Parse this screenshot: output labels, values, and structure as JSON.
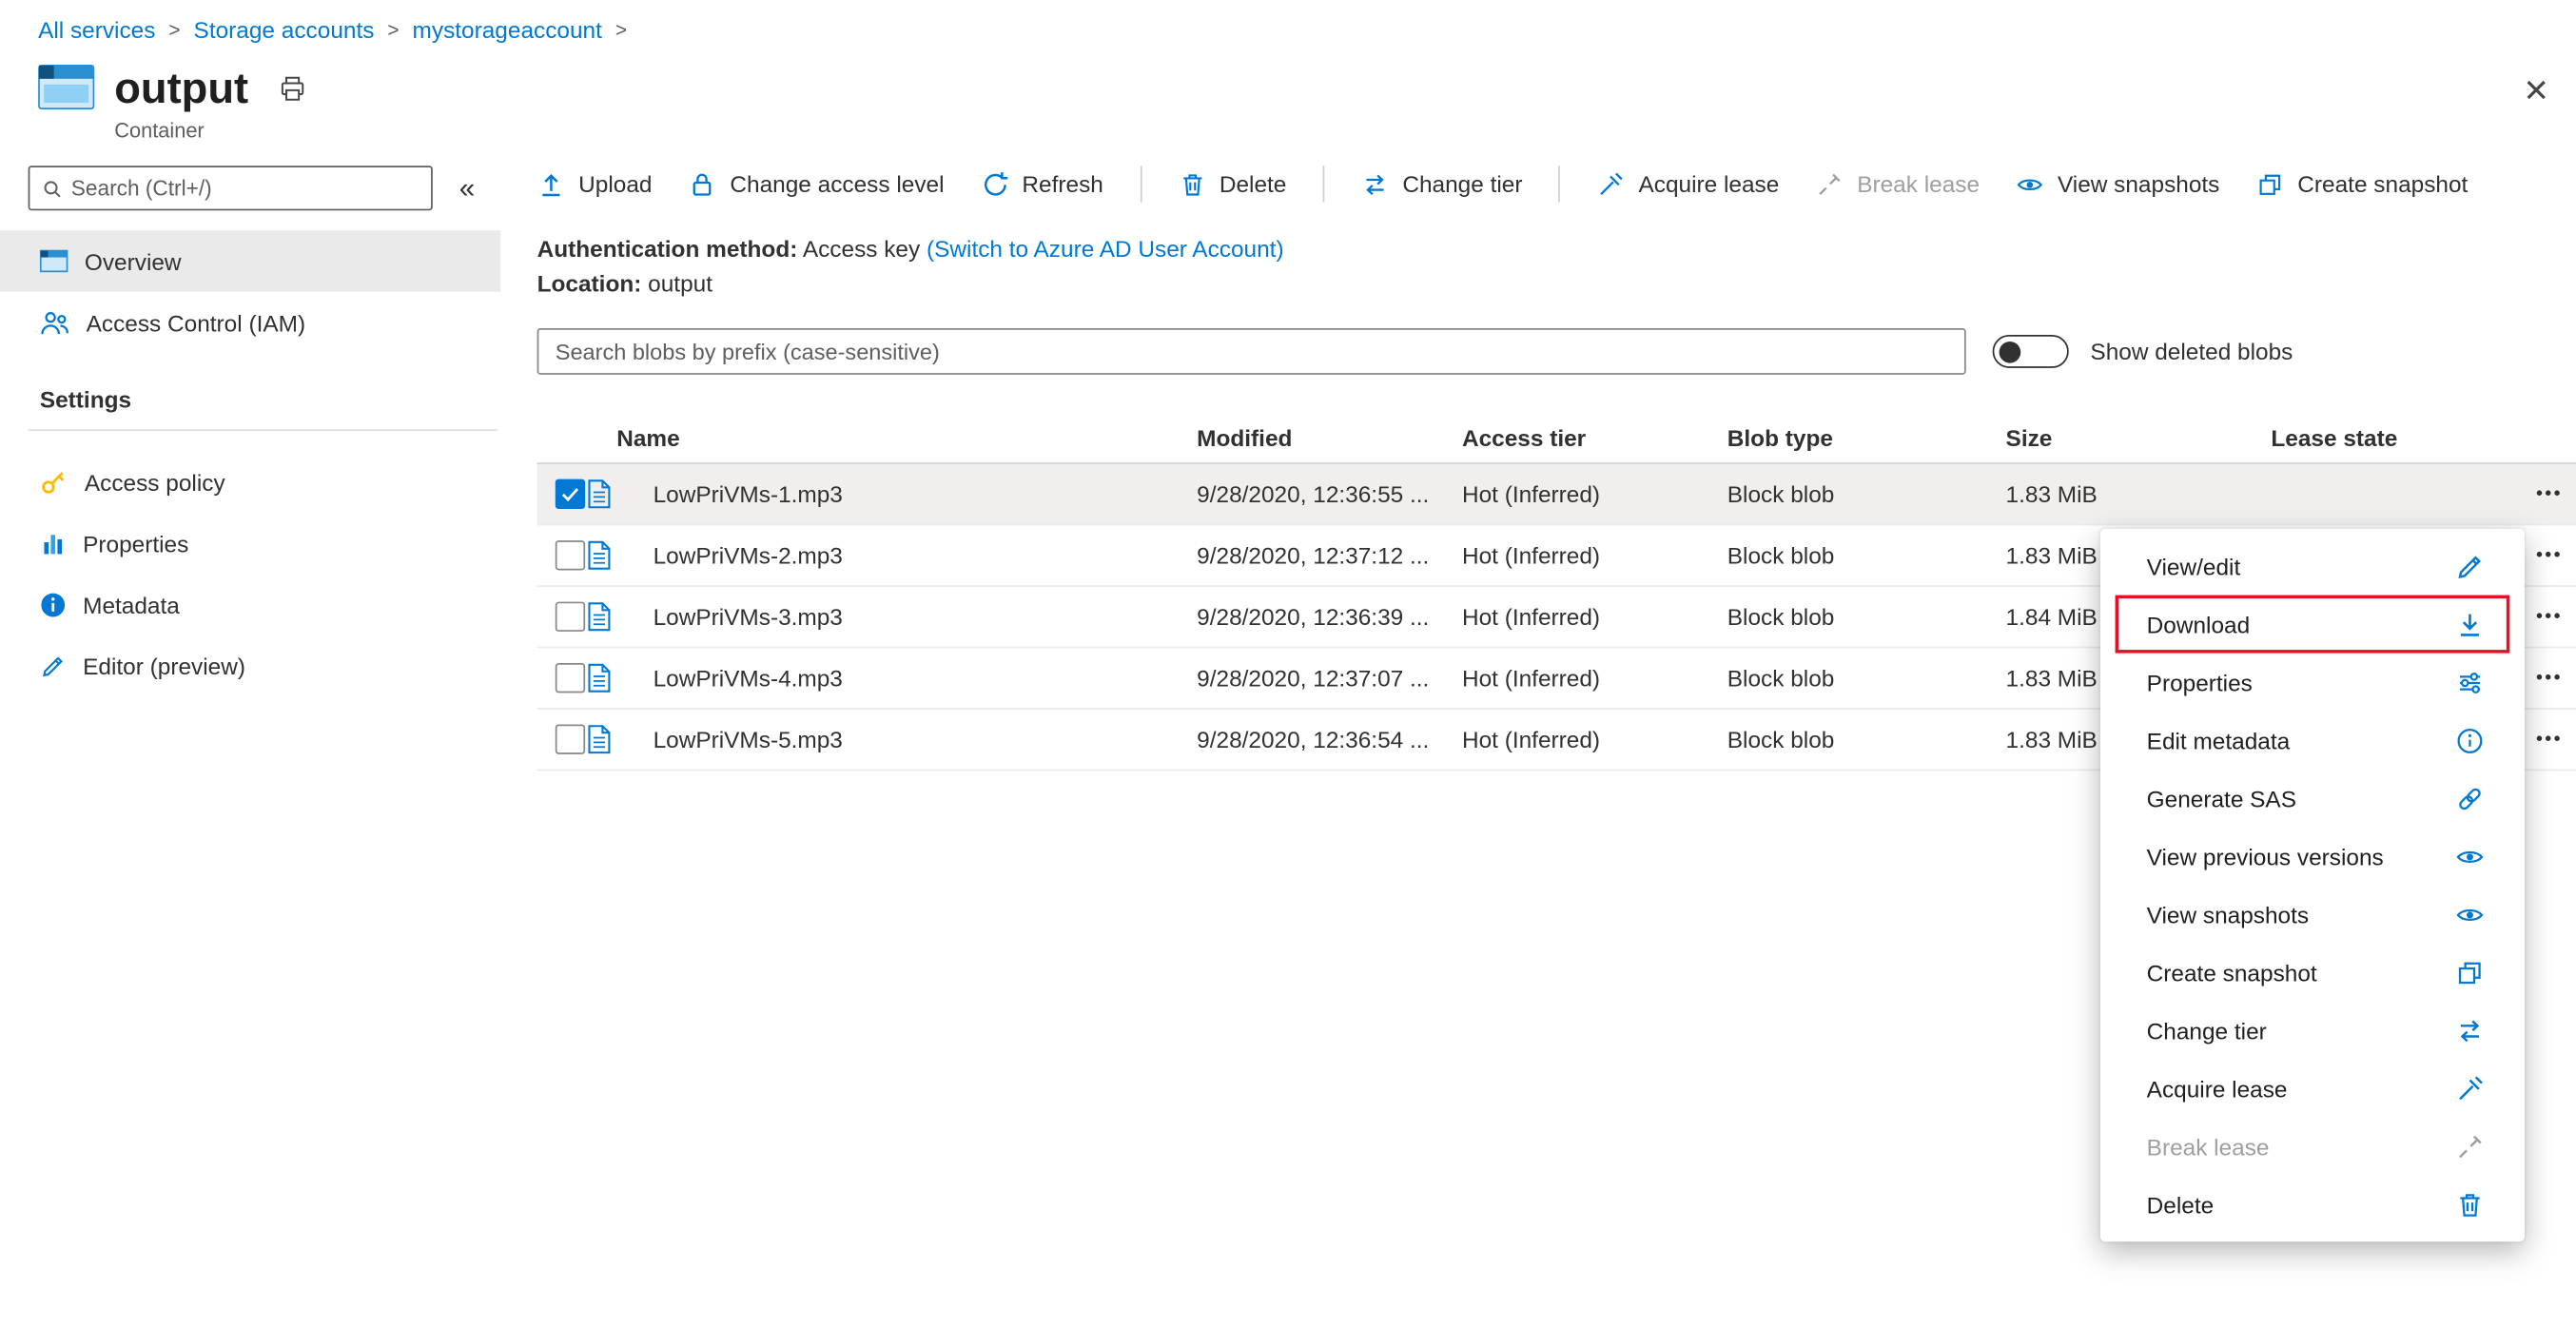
{
  "colors": {
    "accent": "#0078d4",
    "download_highlight_border": "#e81123",
    "selected_row_bg": "#f0efee",
    "disabled_text": "#a19f9d",
    "key_icon_yellow": "#ffb900"
  },
  "icons": {
    "close": "✕",
    "collapse": "«",
    "row_menu": "•••",
    "breadcrumb_separator": ">"
  },
  "breadcrumb": {
    "items": [
      "All services",
      "Storage accounts",
      "mystorageaccount"
    ]
  },
  "header": {
    "title": "output",
    "subtitle": "Container"
  },
  "sidebar": {
    "search_placeholder": "Search (Ctrl+/)",
    "items": [
      {
        "label": "Overview",
        "selected": true
      },
      {
        "label": "Access Control (IAM)",
        "selected": false
      }
    ],
    "settings_header": "Settings",
    "settings_items": [
      {
        "label": "Access policy"
      },
      {
        "label": "Properties"
      },
      {
        "label": "Metadata"
      },
      {
        "label": "Editor (preview)"
      }
    ]
  },
  "toolbar": {
    "items": [
      {
        "label": "Upload",
        "disabled": false
      },
      {
        "label": "Change access level",
        "disabled": false
      },
      {
        "label": "Refresh",
        "disabled": false
      },
      {
        "label": "Delete",
        "disabled": false
      },
      {
        "label": "Change tier",
        "disabled": false
      },
      {
        "label": "Acquire lease",
        "disabled": false
      },
      {
        "label": "Break lease",
        "disabled": true
      },
      {
        "label": "View snapshots",
        "disabled": false
      },
      {
        "label": "Create snapshot",
        "disabled": false
      }
    ]
  },
  "info": {
    "auth_label": "Authentication method:",
    "auth_value": "Access key",
    "auth_link": "(Switch to Azure AD User Account)",
    "location_label": "Location:",
    "location_value": "output"
  },
  "filter": {
    "search_placeholder": "Search blobs by prefix (case-sensitive)",
    "toggle_label": "Show deleted blobs",
    "toggle_on": false
  },
  "table": {
    "columns": [
      "Name",
      "Modified",
      "Access tier",
      "Blob type",
      "Size",
      "Lease state"
    ],
    "rows": [
      {
        "name": "LowPriVMs-1.mp3",
        "modified": "9/28/2020, 12:36:55 ...",
        "access_tier": "Hot (Inferred)",
        "blob_type": "Block blob",
        "size": "1.83 MiB",
        "checked": true
      },
      {
        "name": "LowPriVMs-2.mp3",
        "modified": "9/28/2020, 12:37:12 ...",
        "access_tier": "Hot (Inferred)",
        "blob_type": "Block blob",
        "size": "1.83 MiB",
        "checked": false
      },
      {
        "name": "LowPriVMs-3.mp3",
        "modified": "9/28/2020, 12:36:39 ...",
        "access_tier": "Hot (Inferred)",
        "blob_type": "Block blob",
        "size": "1.84 MiB",
        "checked": false
      },
      {
        "name": "LowPriVMs-4.mp3",
        "modified": "9/28/2020, 12:37:07 ...",
        "access_tier": "Hot (Inferred)",
        "blob_type": "Block blob",
        "size": "1.83 MiB",
        "checked": false
      },
      {
        "name": "LowPriVMs-5.mp3",
        "modified": "9/28/2020, 12:36:54 ...",
        "access_tier": "Hot (Inferred)",
        "blob_type": "Block blob",
        "size": "1.83 MiB",
        "checked": false
      }
    ]
  },
  "context_menu": {
    "items": [
      {
        "label": "View/edit",
        "icon": "pencil-icon",
        "disabled": false,
        "highlighted": false
      },
      {
        "label": "Download",
        "icon": "download-icon",
        "disabled": false,
        "highlighted": true
      },
      {
        "label": "Properties",
        "icon": "sliders-icon",
        "disabled": false,
        "highlighted": false
      },
      {
        "label": "Edit metadata",
        "icon": "info-icon",
        "disabled": false,
        "highlighted": false
      },
      {
        "label": "Generate SAS",
        "icon": "link-icon",
        "disabled": false,
        "highlighted": false
      },
      {
        "label": "View previous versions",
        "icon": "eye-icon",
        "disabled": false,
        "highlighted": false
      },
      {
        "label": "View snapshots",
        "icon": "eye-icon",
        "disabled": false,
        "highlighted": false
      },
      {
        "label": "Create snapshot",
        "icon": "snapshot-icon",
        "disabled": false,
        "highlighted": false
      },
      {
        "label": "Change tier",
        "icon": "change-tier-icon",
        "disabled": false,
        "highlighted": false
      },
      {
        "label": "Acquire lease",
        "icon": "lease-icon",
        "disabled": false,
        "highlighted": false
      },
      {
        "label": "Break lease",
        "icon": "break-lease-icon",
        "disabled": true,
        "highlighted": false
      },
      {
        "label": "Delete",
        "icon": "trash-icon",
        "disabled": false,
        "highlighted": false
      }
    ]
  }
}
